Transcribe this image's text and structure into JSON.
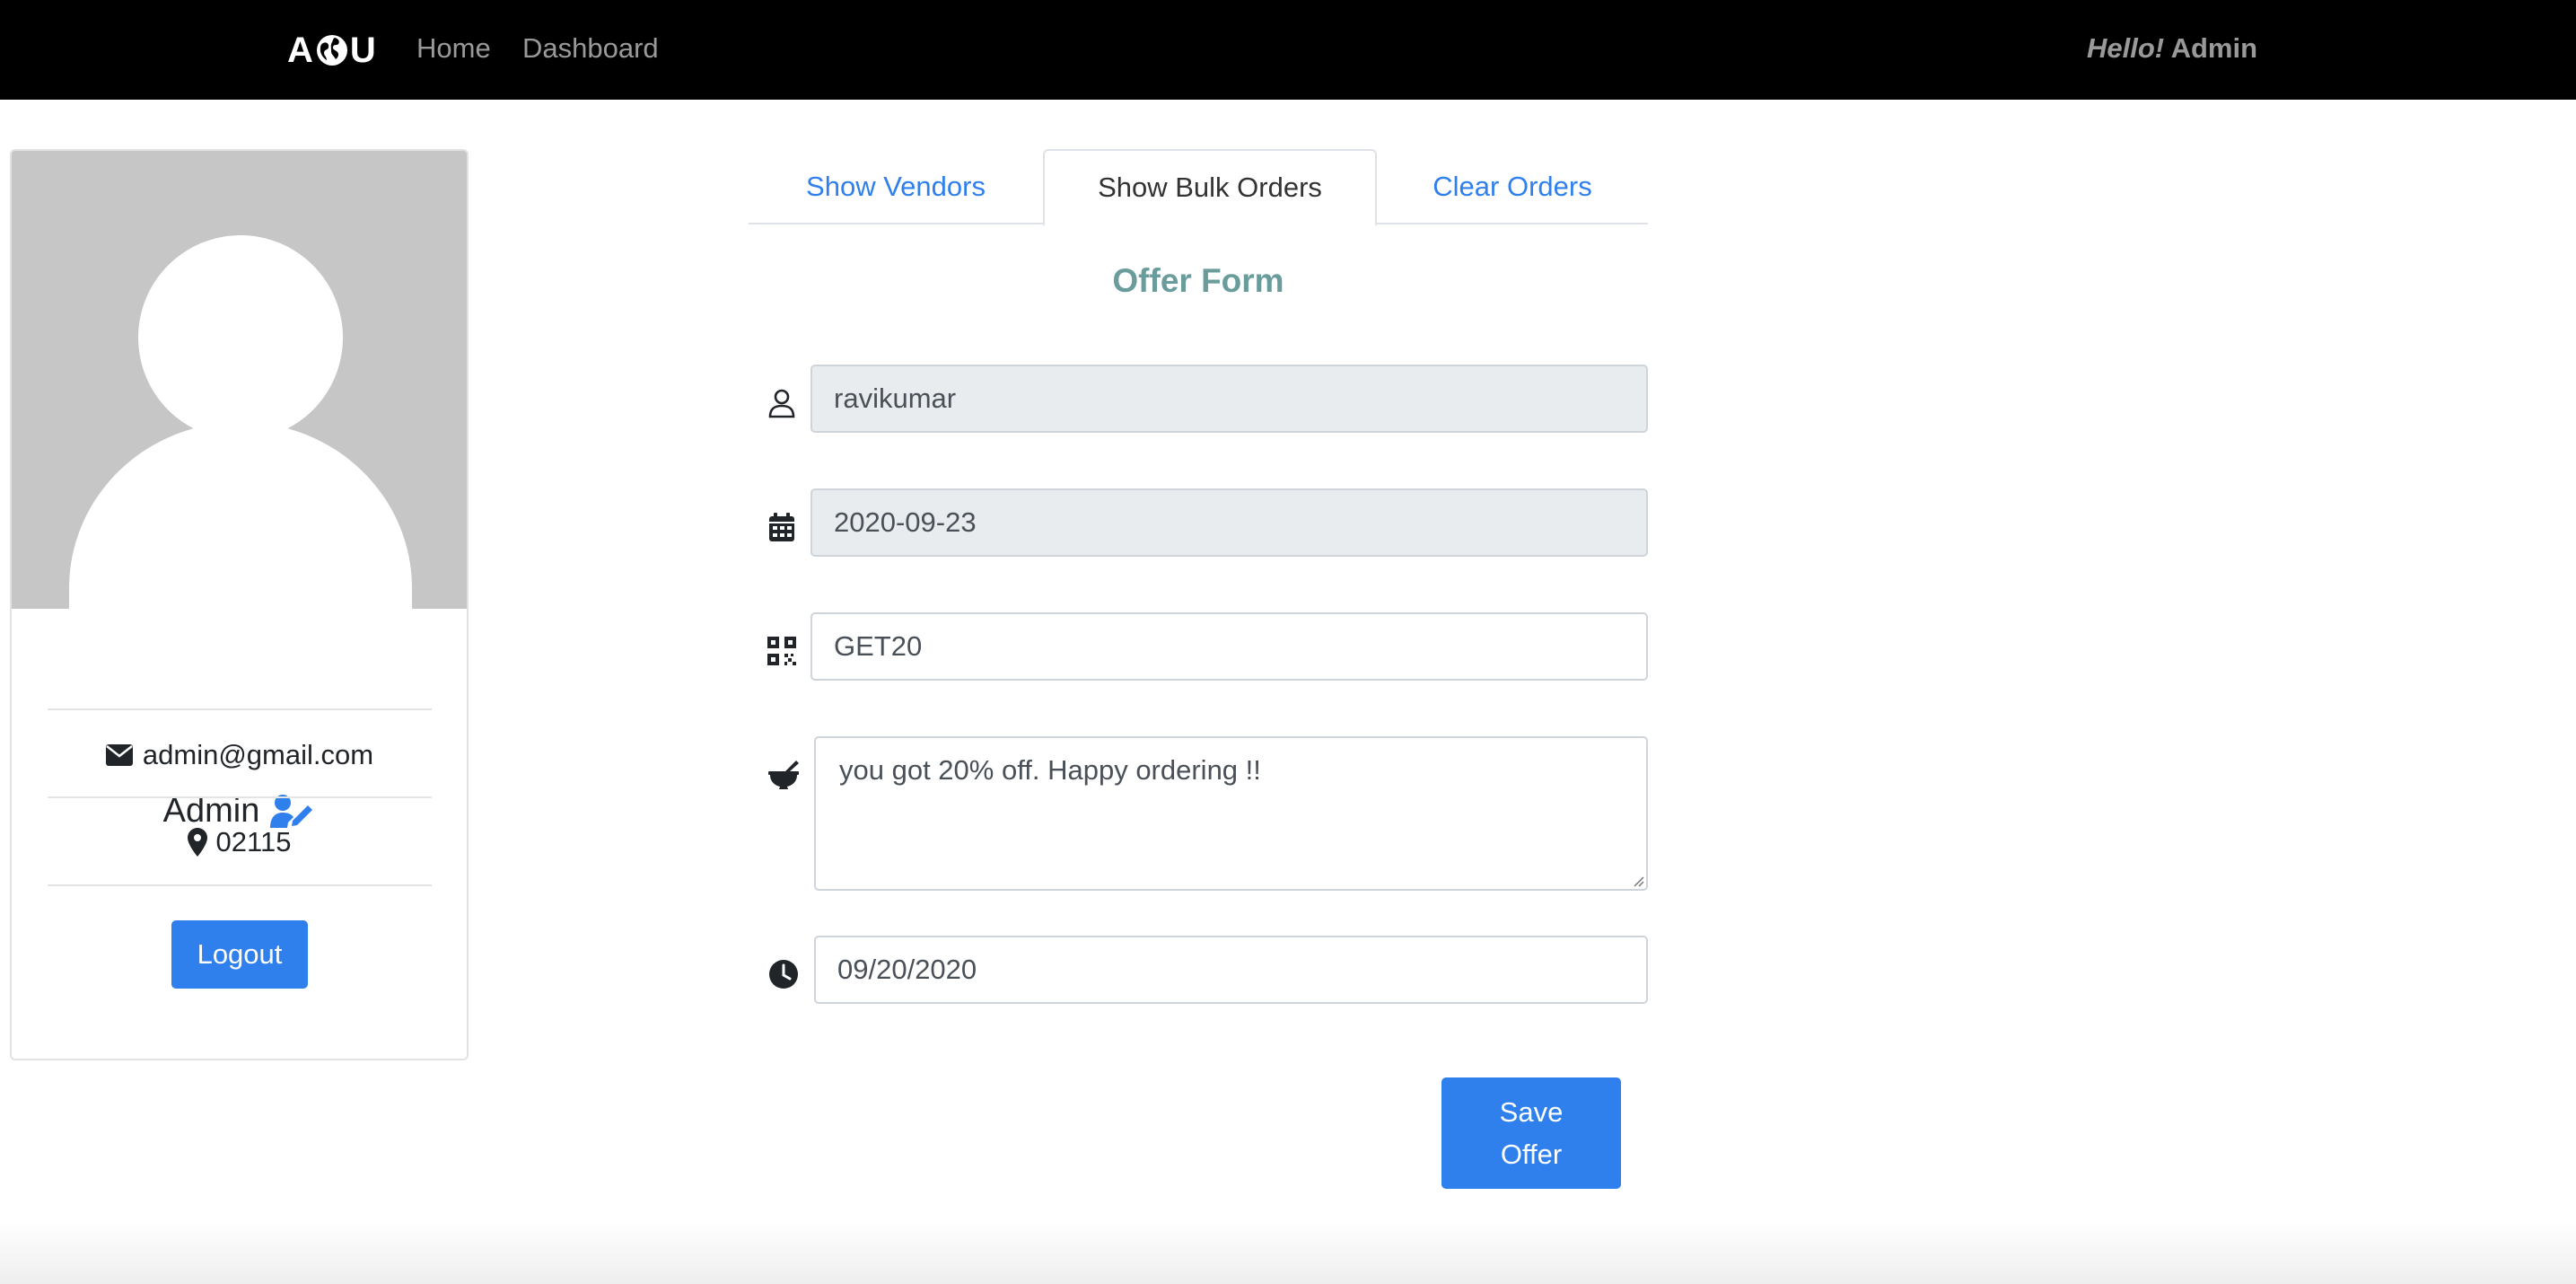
{
  "navbar": {
    "brand_left": "A",
    "brand_right": "U",
    "brand_icon": "globe-icon",
    "links": {
      "home": "Home",
      "dashboard": "Dashboard"
    },
    "greeting_hello": "Hello!",
    "greeting_name": "Admin"
  },
  "profile": {
    "name": "Admin",
    "edit_icon": "user-edit-icon",
    "email": "admin@gmail.com",
    "email_icon": "envelope-icon",
    "zip": "02115",
    "zip_icon": "map-marker-icon",
    "logout_label": "Logout"
  },
  "tabs": [
    {
      "label": "Show Vendors",
      "active": false
    },
    {
      "label": "Show Bulk Orders",
      "active": true
    },
    {
      "label": "Clear Orders",
      "active": false
    }
  ],
  "form": {
    "title": "Offer Form",
    "fields": {
      "username": {
        "icon": "user-icon",
        "value": "ravikumar",
        "disabled": true
      },
      "date": {
        "icon": "calendar-icon",
        "value": "2020-09-23",
        "disabled": true
      },
      "code": {
        "icon": "qrcode-icon",
        "value": "GET20",
        "disabled": false
      },
      "message": {
        "icon": "mortar-pestle-icon",
        "value": "you got 20% off. Happy ordering !!"
      },
      "expiry": {
        "icon": "clock-icon",
        "value": "09/20/2020"
      }
    },
    "save_label_line1": "Save",
    "save_label_line2": "Offer"
  },
  "colors": {
    "primary": "#2f80ed",
    "navbar_bg": "#000000",
    "form_title": "#6a9c9c",
    "disabled_input": "#e9ecef"
  }
}
